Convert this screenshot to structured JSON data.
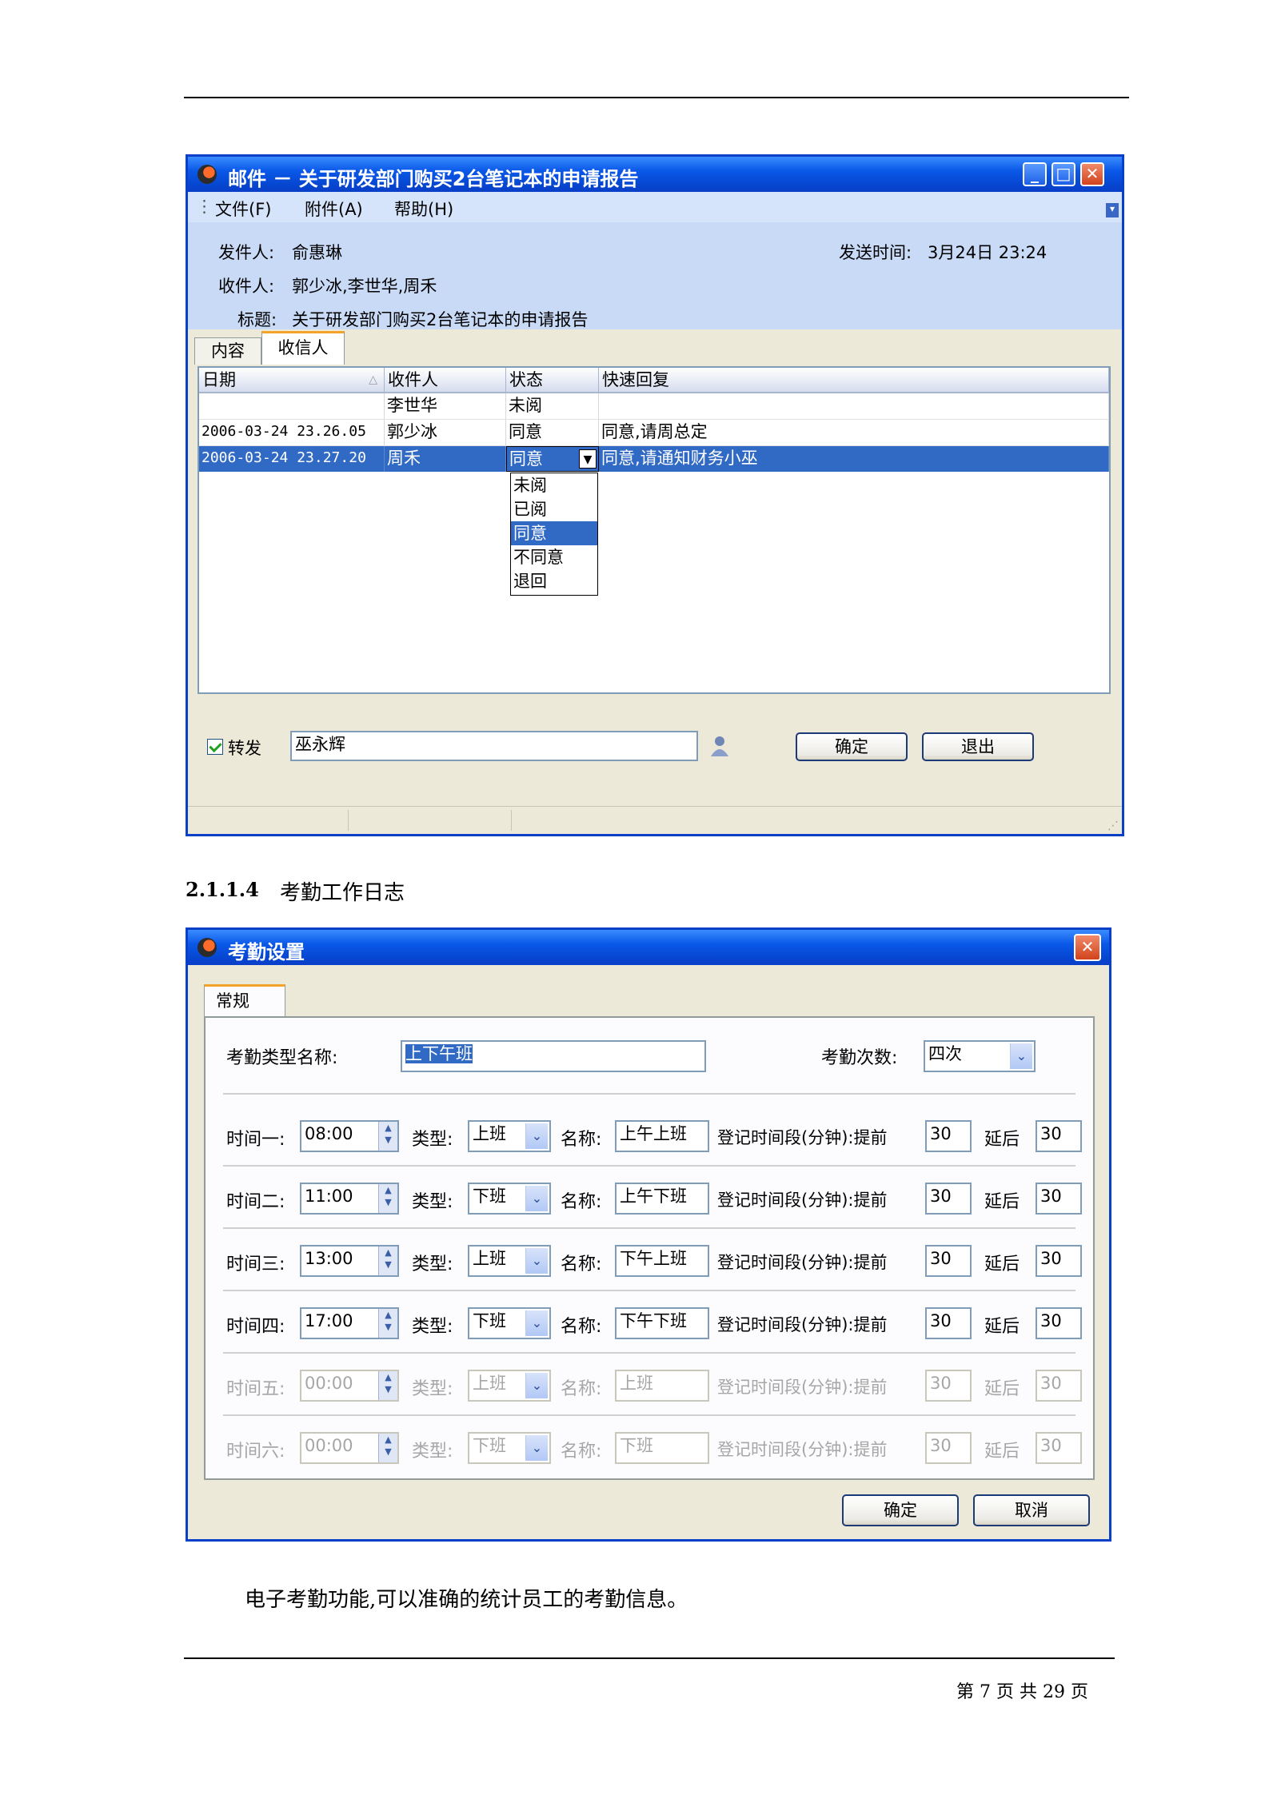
{
  "mail_window": {
    "title": "邮件 － 关于研发部门购买2台笔记本的申请报告",
    "menu": [
      "文件(F)",
      "附件(A)",
      "帮助(H)"
    ],
    "sender_label": "发件人:",
    "sender": "俞惠琳",
    "send_time_label": "发送时间:",
    "send_time": "3月24日 23:24",
    "recipients_label": "收件人:",
    "recipients": "郭少冰,李世华,周禾",
    "subject_label": "标题:",
    "subject": "关于研发部门购买2台笔记本的申请报告",
    "tabs": [
      "内容",
      "收信人"
    ],
    "columns": [
      "日期",
      "收件人",
      "状态",
      "快速回复"
    ],
    "rows": [
      {
        "date": "",
        "recipient": "李世华",
        "status": "未阅",
        "reply": ""
      },
      {
        "date": "2006-03-24 23.26.05",
        "recipient": "郭少冰",
        "status": "同意",
        "reply": "同意,请周总定"
      },
      {
        "date": "2006-03-24 23.27.20",
        "recipient": "周禾",
        "status": "同意",
        "reply": "同意,请通知财务小巫"
      }
    ],
    "status_options": [
      "未阅",
      "已阅",
      "同意",
      "不同意",
      "退回"
    ],
    "forward_label": "转发",
    "forward_to": "巫永辉",
    "ok_button": "确定",
    "exit_button": "退出"
  },
  "section": {
    "number": "2.1.1.4",
    "title": "考勤工作日志"
  },
  "attendance_window": {
    "title": "考勤设置",
    "tab": "常规",
    "type_name_label": "考勤类型名称:",
    "type_name": "上下午班",
    "count_label": "考勤次数:",
    "count": "四次",
    "type_label": "类型:",
    "name_label": "名称:",
    "period_label": "登记时间段(分钟):提前",
    "after_label": "延后",
    "rows": [
      {
        "label": "时间一:",
        "time": "08:00",
        "type": "上班",
        "name": "上午上班",
        "before": "30",
        "after": "30"
      },
      {
        "label": "时间二:",
        "time": "11:00",
        "type": "下班",
        "name": "上午下班",
        "before": "30",
        "after": "30"
      },
      {
        "label": "时间三:",
        "time": "13:00",
        "type": "上班",
        "name": "下午上班",
        "before": "30",
        "after": "30"
      },
      {
        "label": "时间四:",
        "time": "17:00",
        "type": "下班",
        "name": "下午下班",
        "before": "30",
        "after": "30"
      },
      {
        "label": "时间五:",
        "time": "00:00",
        "type": "上班",
        "name": "上班",
        "before": "30",
        "after": "30"
      },
      {
        "label": "时间六:",
        "time": "00:00",
        "type": "下班",
        "name": "下班",
        "before": "30",
        "after": "30"
      }
    ],
    "ok_button": "确定",
    "cancel_button": "取消"
  },
  "body_text": "电子考勤功能,可以准确的统计员工的考勤信息。",
  "footer": {
    "page_label": "第 7 页 共 29 页"
  }
}
